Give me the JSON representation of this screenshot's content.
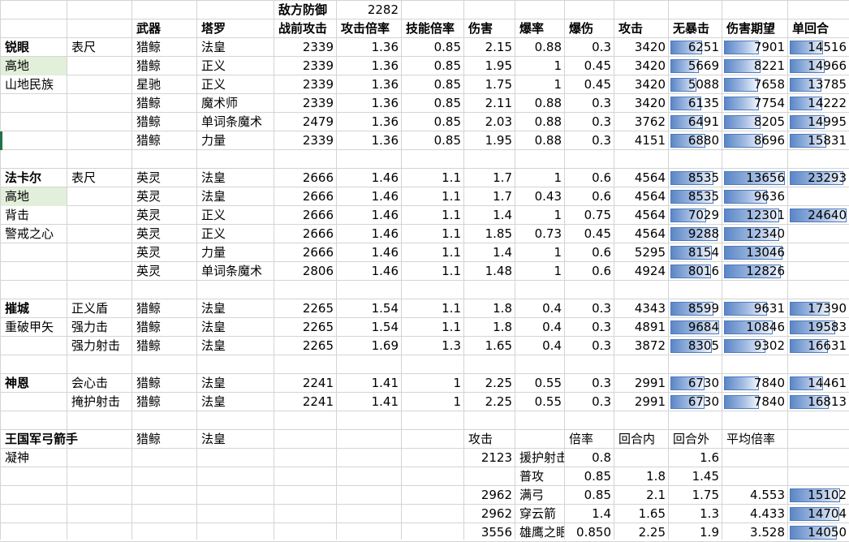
{
  "colors": {
    "databar_fill": "#5b86c6",
    "databar_border": "#4f7bbf",
    "selected_cell": "#e2efda",
    "gridline": "#d4d4d4"
  },
  "top": {
    "enemy_def_label": "敌方防御",
    "enemy_def_value": "2282"
  },
  "headers": [
    "武器",
    "塔罗",
    "战前攻击",
    "攻击倍率",
    "技能倍率",
    "伤害",
    "爆率",
    "爆伤",
    "攻击",
    "无暴击",
    "伤害期望",
    "单回合"
  ],
  "sections": [
    {
      "labels": [
        "锐眼",
        "高地",
        "山地民族"
      ],
      "sub": [
        "表尺"
      ],
      "rows": [
        {
          "weapon": "猎鲸",
          "tarot": "法皇",
          "pre_atk": "2339",
          "atk_mult": "1.36",
          "skill_mult": "0.85",
          "dmg": "2.15",
          "crit_rate": "0.88",
          "crit_dmg": "0.3",
          "atk": "3420",
          "no_crit": 6251,
          "expected": 7901,
          "single": 14516
        },
        {
          "weapon": "猎鲸",
          "tarot": "正义",
          "pre_atk": "2339",
          "atk_mult": "1.36",
          "skill_mult": "0.85",
          "dmg": "1.95",
          "crit_rate": "1",
          "crit_dmg": "0.45",
          "atk": "3420",
          "no_crit": 5669,
          "expected": 8221,
          "single": 14966
        },
        {
          "weapon": "星驰",
          "tarot": "正义",
          "pre_atk": "2339",
          "atk_mult": "1.36",
          "skill_mult": "0.85",
          "dmg": "1.75",
          "crit_rate": "1",
          "crit_dmg": "0.45",
          "atk": "3420",
          "no_crit": 5088,
          "expected": 7658,
          "single": 13785
        },
        {
          "weapon": "猎鲸",
          "tarot": "魔术师",
          "pre_atk": "2339",
          "atk_mult": "1.36",
          "skill_mult": "0.85",
          "dmg": "2.11",
          "crit_rate": "0.88",
          "crit_dmg": "0.3",
          "atk": "3420",
          "no_crit": 6135,
          "expected": 7754,
          "single": 14222
        },
        {
          "weapon": "猎鲸",
          "tarot": "单词条魔术",
          "pre_atk": "2479",
          "atk_mult": "1.36",
          "skill_mult": "0.85",
          "dmg": "2.03",
          "crit_rate": "0.88",
          "crit_dmg": "0.3",
          "atk": "3762",
          "no_crit": 6491,
          "expected": 8205,
          "single": 14995
        },
        {
          "weapon": "猎鲸",
          "tarot": "力量",
          "pre_atk": "2339",
          "atk_mult": "1.36",
          "skill_mult": "0.85",
          "dmg": "1.95",
          "crit_rate": "0.88",
          "crit_dmg": "0.3",
          "atk": "4151",
          "no_crit": 6880,
          "expected": 8696,
          "single": 15831
        }
      ]
    },
    {
      "labels": [
        "法卡尔",
        "高地",
        "背击",
        "警戒之心"
      ],
      "sub": [
        "表尺"
      ],
      "rows": [
        {
          "weapon": "英灵",
          "tarot": "法皇",
          "pre_atk": "2666",
          "atk_mult": "1.46",
          "skill_mult": "1.1",
          "dmg": "1.7",
          "crit_rate": "1",
          "crit_dmg": "0.6",
          "atk": "4564",
          "no_crit": 8535,
          "expected": 13656,
          "single": 23293
        },
        {
          "weapon": "英灵",
          "tarot": "法皇",
          "pre_atk": "2666",
          "atk_mult": "1.46",
          "skill_mult": "1.1",
          "dmg": "1.7",
          "crit_rate": "0.43",
          "crit_dmg": "0.6",
          "atk": "4564",
          "no_crit": 8535,
          "expected": 9636,
          "single": null
        },
        {
          "weapon": "英灵",
          "tarot": "正义",
          "pre_atk": "2666",
          "atk_mult": "1.46",
          "skill_mult": "1.1",
          "dmg": "1.4",
          "crit_rate": "1",
          "crit_dmg": "0.75",
          "atk": "4564",
          "no_crit": 7029,
          "expected": 12301,
          "single": 24640
        },
        {
          "weapon": "英灵",
          "tarot": "正义",
          "pre_atk": "2666",
          "atk_mult": "1.46",
          "skill_mult": "1.1",
          "dmg": "1.85",
          "crit_rate": "0.73",
          "crit_dmg": "0.45",
          "atk": "4564",
          "no_crit": 9288,
          "expected": 12340,
          "single": null
        },
        {
          "weapon": "英灵",
          "tarot": "力量",
          "pre_atk": "2666",
          "atk_mult": "1.46",
          "skill_mult": "1.1",
          "dmg": "1.4",
          "crit_rate": "1",
          "crit_dmg": "0.6",
          "atk": "5295",
          "no_crit": 8154,
          "expected": 13046,
          "single": null
        },
        {
          "weapon": "英灵",
          "tarot": "单词条魔术",
          "pre_atk": "2806",
          "atk_mult": "1.46",
          "skill_mult": "1.1",
          "dmg": "1.48",
          "crit_rate": "1",
          "crit_dmg": "0.6",
          "atk": "4924",
          "no_crit": 8016,
          "expected": 12826,
          "single": null
        }
      ]
    },
    {
      "labels": [
        "摧城",
        "重破甲矢"
      ],
      "sub": [
        "正义盾",
        "强力击",
        "强力射击"
      ],
      "rows": [
        {
          "weapon": "猎鲸",
          "tarot": "法皇",
          "pre_atk": "2265",
          "atk_mult": "1.54",
          "skill_mult": "1.1",
          "dmg": "1.8",
          "crit_rate": "0.4",
          "crit_dmg": "0.3",
          "atk": "4343",
          "no_crit": 8599,
          "expected": 9631,
          "single": 17390
        },
        {
          "weapon": "猎鲸",
          "tarot": "法皇",
          "pre_atk": "2265",
          "atk_mult": "1.54",
          "skill_mult": "1.1",
          "dmg": "1.8",
          "crit_rate": "0.4",
          "crit_dmg": "0.3",
          "atk": "4891",
          "no_crit": 9684,
          "expected": 10846,
          "single": 19583
        },
        {
          "weapon": "猎鲸",
          "tarot": "法皇",
          "pre_atk": "2265",
          "atk_mult": "1.69",
          "skill_mult": "1.3",
          "dmg": "1.65",
          "crit_rate": "0.4",
          "crit_dmg": "0.3",
          "atk": "3872",
          "no_crit": 8305,
          "expected": 9302,
          "single": 16631
        }
      ]
    },
    {
      "labels": [
        "神恩"
      ],
      "sub": [
        "会心击",
        "掩护射击"
      ],
      "rows": [
        {
          "weapon": "猎鲸",
          "tarot": "法皇",
          "pre_atk": "2241",
          "atk_mult": "1.41",
          "skill_mult": "1",
          "dmg": "2.25",
          "crit_rate": "0.55",
          "crit_dmg": "0.3",
          "atk": "2991",
          "no_crit": 6730,
          "expected": 7840,
          "single": 14461
        },
        {
          "weapon": "猎鲸",
          "tarot": "法皇",
          "pre_atk": "2241",
          "atk_mult": "1.41",
          "skill_mult": "1",
          "dmg": "2.25",
          "crit_rate": "0.55",
          "crit_dmg": "0.3",
          "atk": "2991",
          "no_crit": 6730,
          "expected": 7840,
          "single": 16813
        }
      ]
    }
  ],
  "archer": {
    "title": "王国军弓箭手",
    "sub": "凝神",
    "weapon": "猎鲸",
    "tarot": "法皇",
    "headers": [
      "攻击",
      "倍率",
      "回合内",
      "回合外",
      "平均倍率"
    ],
    "rows": [
      {
        "atk": "2123",
        "skill": "援护射击",
        "mult": "0.8",
        "in_round": "",
        "out_round": "1.6",
        "avg": "",
        "single": null
      },
      {
        "atk": "",
        "skill": "普攻",
        "mult": "0.85",
        "in_round": "1.8",
        "out_round": "1.45",
        "avg": "",
        "single": null
      },
      {
        "atk": "2962",
        "skill": "满弓",
        "mult": "0.85",
        "in_round": "2.1",
        "out_round": "1.75",
        "avg": "4.553",
        "single": 15102
      },
      {
        "atk": "2962",
        "skill": "穿云箭",
        "mult": "1.4",
        "in_round": "1.65",
        "out_round": "1.3",
        "avg": "4.433",
        "single": 14704
      },
      {
        "atk": "3556",
        "skill": "雄鹰之眼",
        "mult": "0.850",
        "in_round": "2.25",
        "out_round": "1.9",
        "avg": "3.528",
        "single": 14050
      }
    ]
  }
}
